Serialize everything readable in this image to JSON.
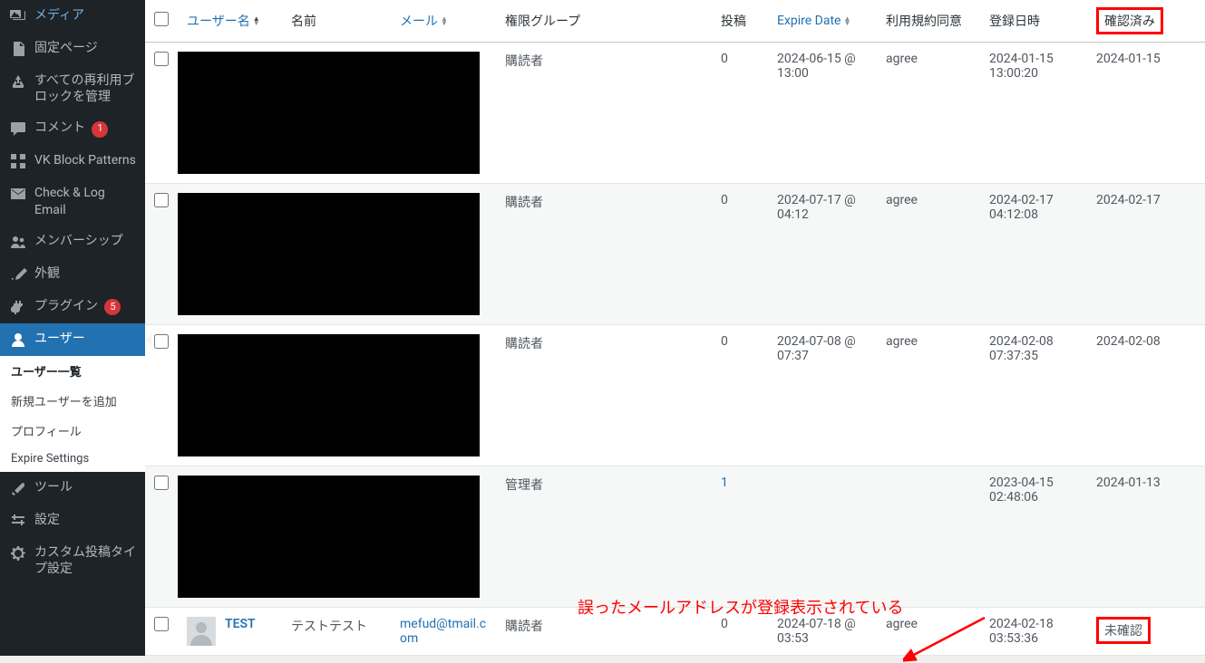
{
  "sidebar": {
    "items": [
      {
        "icon": "media",
        "label": "メディア"
      },
      {
        "icon": "page",
        "label": "固定ページ"
      },
      {
        "icon": "recycle",
        "label": "すべての再利用ブロックを管理"
      },
      {
        "icon": "comment",
        "label": "コメント",
        "badge": "1"
      },
      {
        "icon": "grid",
        "label": "VK Block Patterns"
      },
      {
        "icon": "mail",
        "label": "Check & Log Email"
      },
      {
        "icon": "users",
        "label": "メンバーシップ"
      },
      {
        "icon": "brush",
        "label": "外観"
      },
      {
        "icon": "plug",
        "label": "プラグイン",
        "badge": "5"
      },
      {
        "icon": "user",
        "label": "ユーザー",
        "current": true
      }
    ],
    "submenu": [
      {
        "label": "ユーザー一覧",
        "active": true
      },
      {
        "label": "新規ユーザーを追加"
      },
      {
        "label": "プロフィール"
      },
      {
        "label": "Expire Settings"
      }
    ],
    "items2": [
      {
        "icon": "wrench",
        "label": "ツール"
      },
      {
        "icon": "sliders",
        "label": "設定"
      },
      {
        "icon": "gear",
        "label": "カスタム投稿タイプ設定"
      }
    ]
  },
  "table": {
    "headers": {
      "username": "ユーザー名",
      "name": "名前",
      "email": "メール",
      "role": "権限グループ",
      "posts": "投稿",
      "expire": "Expire Date",
      "agree": "利用規約同意",
      "registered": "登録日時",
      "confirmed": "確認済み"
    },
    "rows": [
      {
        "role": "購読者",
        "posts": "0",
        "expire": "2024-06-15 @ 13:00",
        "agree": "agree",
        "reg": "2024-01-15 13:00:20",
        "conf": "2024-01-15",
        "redacted": true
      },
      {
        "role": "購読者",
        "posts": "0",
        "expire": "2024-07-17 @ 04:12",
        "agree": "agree",
        "reg": "2024-02-17 04:12:08",
        "conf": "2024-02-17",
        "redacted": true
      },
      {
        "role": "購読者",
        "posts": "0",
        "expire": "2024-07-08 @ 07:37",
        "agree": "agree",
        "reg": "2024-02-08 07:37:35",
        "conf": "2024-02-08",
        "redacted": true
      },
      {
        "role": "管理者",
        "posts": "1",
        "posts_link": true,
        "expire": "",
        "agree": "",
        "reg": "2023-04-15 02:48:06",
        "conf": "2024-01-13",
        "redacted": true
      },
      {
        "username": "TEST",
        "name": "テストテスト",
        "email": "mefud@tmail.com",
        "role": "購読者",
        "posts": "0",
        "expire": "2024-07-18 @ 03:53",
        "agree": "agree",
        "reg": "2024-02-18 03:53:36",
        "conf": "未確認",
        "conf_hl": true
      }
    ]
  },
  "annotation": {
    "text": "誤ったメールアドレスが登録表示されている"
  }
}
